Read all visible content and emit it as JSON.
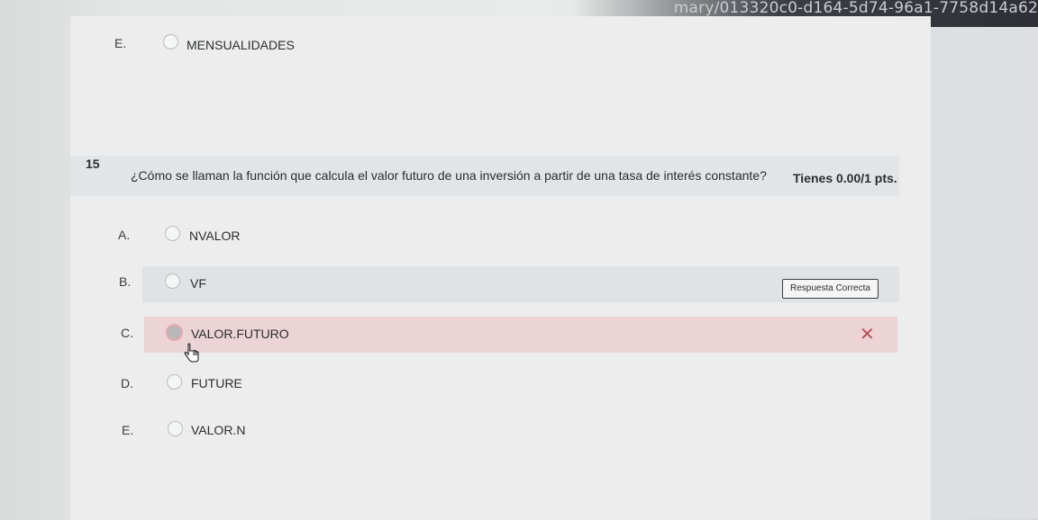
{
  "browser": {
    "url_fragment": "mary/013320c0-d164-5d74-96a1-7758d14a62"
  },
  "previous_question": {
    "option_e": {
      "letter": "E.",
      "text": "MENSUALIDADES"
    }
  },
  "question": {
    "number": "15",
    "text": "¿Cómo se llaman la función que calcula el valor futuro de una inversión a partir de una tasa de interés constante?",
    "score": "Tienes 0.00/1 pts.",
    "options": [
      {
        "letter": "A.",
        "text": "NVALOR"
      },
      {
        "letter": "B.",
        "text": "VF"
      },
      {
        "letter": "C.",
        "text": "VALOR.FUTURO"
      },
      {
        "letter": "D.",
        "text": "FUTURE"
      },
      {
        "letter": "E.",
        "text": "VALOR.N"
      }
    ],
    "selected_option": "C.",
    "correct_option": "B.",
    "correct_badge": "Respuesta Correcta",
    "wrong_mark": "✕"
  },
  "colors": {
    "correct_row": "#dfe3e6",
    "wrong_row": "#ebd3d6",
    "wrong_mark": "#b84e5b"
  }
}
